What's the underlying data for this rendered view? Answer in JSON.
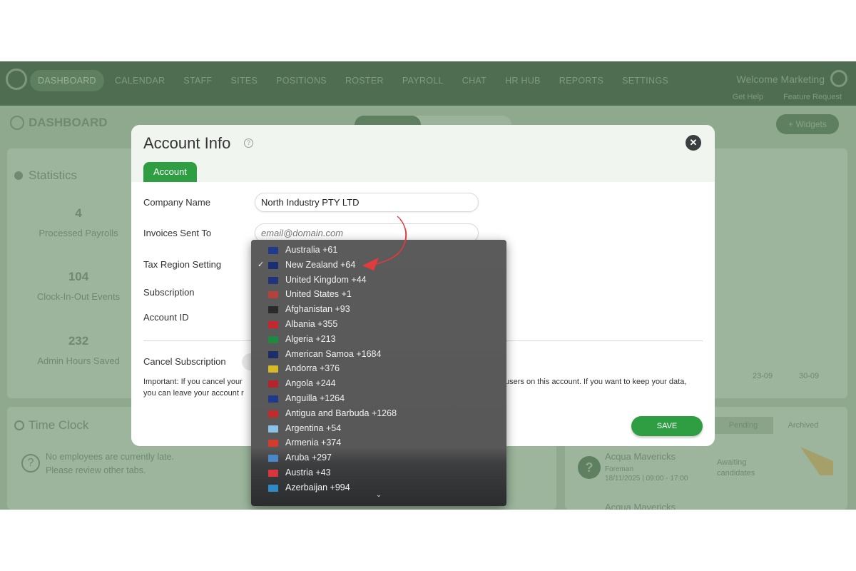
{
  "app": {
    "nav": [
      "DASHBOARD",
      "CALENDAR",
      "STAFF",
      "SITES",
      "POSITIONS",
      "ROSTER",
      "PAYROLL",
      "CHAT",
      "HR HUB",
      "REPORTS",
      "SETTINGS"
    ],
    "welcome": "Welcome Marketing",
    "help": "Get Help",
    "feature_request": "Feature Request",
    "dashboard_title": "DASHBOARD",
    "widgets_button": "+ Widgets",
    "statistics_title": "Statistics",
    "stats": [
      {
        "value": "4",
        "label": "Processed Payrolls"
      },
      {
        "value": "104",
        "label": "Clock-In-Out Events"
      },
      {
        "value": "232",
        "label": "Admin Hours Saved"
      }
    ],
    "chart_ticks": [
      "23-09",
      "30-09"
    ],
    "time_clock_title": "Time Clock",
    "late_message": [
      "No employees are currently late.",
      "Please review other tabs."
    ],
    "shift_tabs": [
      "Pending",
      "Archived"
    ],
    "shift": {
      "name": "Acqua Mavericks",
      "role": "Foreman",
      "time": "18/11/2025 | 09:00 - 17:00",
      "status": "Awaiting candidates",
      "next_name": "Acqua Mavericks"
    }
  },
  "modal": {
    "title": "Account Info",
    "tab": "Account",
    "fields": {
      "company_label": "Company Name",
      "company_value": "North Industry PTY LTD",
      "invoices_label": "Invoices Sent To",
      "invoices_placeholder": "email@domain.com",
      "tax_label": "Tax Region Setting",
      "subscription_label": "Subscription",
      "account_id_label": "Account ID",
      "cancel_label": "Cancel Subscription"
    },
    "important_1": "Important: If you cancel your",
    "important_2": "users on this account. If you want to keep your data,",
    "important_3": "you can leave your account r",
    "save": "SAVE"
  },
  "dropdown": {
    "selected": "New Zealand +64",
    "items": [
      {
        "label": "Australia +61",
        "flag": "#1f3a8a"
      },
      {
        "label": "New Zealand +64",
        "flag": "#1a2f73",
        "checked": "✓"
      },
      {
        "label": "United Kingdom +44",
        "flag": "#22337a"
      },
      {
        "label": "United States +1",
        "flag": "#b3413c"
      },
      {
        "label": "Afghanistan +93",
        "flag": "#2a2a2a"
      },
      {
        "label": "Albania +355",
        "flag": "#c6262e"
      },
      {
        "label": "Algeria +213",
        "flag": "#1d8a3f"
      },
      {
        "label": "American Samoa +1684",
        "flag": "#1d2d6a"
      },
      {
        "label": "Andorra +376",
        "flag": "#d8b92a"
      },
      {
        "label": "Angola +244",
        "flag": "#b8222a"
      },
      {
        "label": "Anguilla +1264",
        "flag": "#1f3a8a"
      },
      {
        "label": "Antigua and Barbuda +1268",
        "flag": "#c42a2a"
      },
      {
        "label": "Argentina +54",
        "flag": "#8ac3e6"
      },
      {
        "label": "Armenia +374",
        "flag": "#d23b2e"
      },
      {
        "label": "Aruba +297",
        "flag": "#4a87c8"
      },
      {
        "label": "Austria +43",
        "flag": "#d8363c"
      },
      {
        "label": "Azerbaijan +994",
        "flag": "#2f8bc6"
      }
    ]
  }
}
